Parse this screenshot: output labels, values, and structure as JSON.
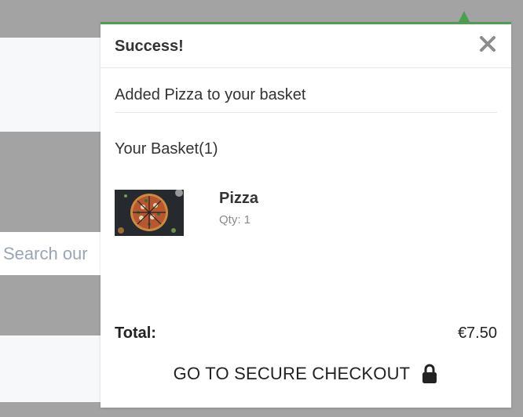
{
  "background": {
    "search_placeholder": "Search our"
  },
  "toast": {
    "title": "Success!",
    "close_icon": "close-icon",
    "message": "Added Pizza to your basket",
    "accent_color": "#4aa050"
  },
  "basket": {
    "heading": "Your Basket(1)",
    "items": [
      {
        "name": "Pizza",
        "qty": "Qty: 1",
        "thumbnail": "pizza-image"
      }
    ],
    "total_label": "Total:",
    "total_value": "€7.50"
  },
  "checkout": {
    "label": "GO TO SECURE CHECKOUT",
    "icon": "lock-icon"
  }
}
